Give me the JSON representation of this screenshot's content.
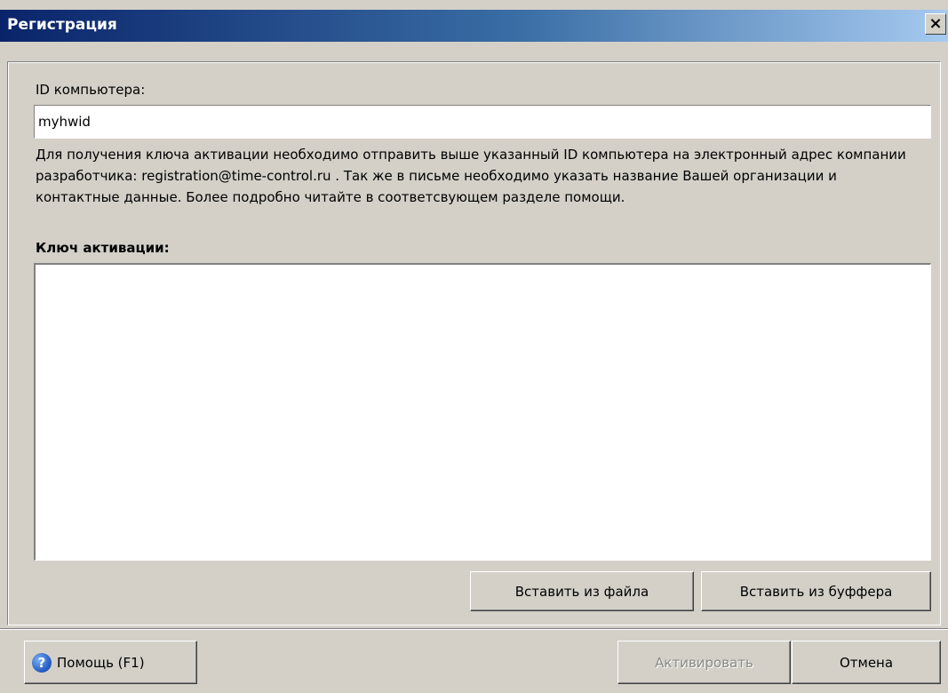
{
  "window": {
    "title": "Регистрация",
    "close_glyph": "×",
    "close_icon": "close-icon"
  },
  "form": {
    "id_label": "ID компьютера:",
    "id_value": "myhwid",
    "info_text": "Для получения ключа активации необходимо отправить выше указанный ID компьютера на электронный адрес компании разработчика: registration@time-control.ru . Так же в письме необходимо указать название Вашей организации и контактные данные. Более подробно читайте в соответсвующем разделе помощи.",
    "key_label": "Ключ активации:",
    "key_value": ""
  },
  "buttons": {
    "paste_file": "Вставить из файла",
    "paste_buffer": "Вставить из буффера",
    "help": "Помощь (F1)",
    "help_icon": "help-icon",
    "help_glyph": "?",
    "activate": "Активировать",
    "activate_enabled": false,
    "cancel": "Отмена"
  },
  "colors": {
    "title_bar_start": "#0a246a",
    "title_bar_end": "#a6caf0",
    "dialog_bg": "#d4d0c8",
    "disabled_text": "#8c8a84"
  }
}
